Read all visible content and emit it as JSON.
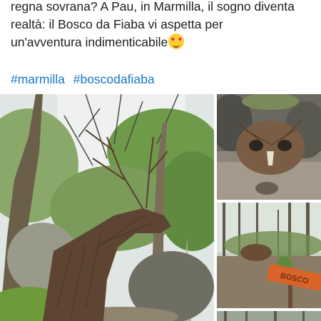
{
  "post": {
    "caption_lines": [
      "regna sovrana? A Pau, in Marmilla, il sogno diventa",
      "realtà: il Bosco da Fiaba vi aspetta per",
      "un'avventura indimenticabile"
    ],
    "emoji": "smiling-face-with-heart-eyes-icon",
    "hashtags": [
      "#marmilla",
      "#boscodafiaba"
    ]
  },
  "photos": {
    "main": "deer-branch-sculpture-photo",
    "side_1": "owl-branch-sculpture-photo",
    "side_2": "forest-sign-photo",
    "side_3": "forest-photo-partial",
    "sign_text": "BOSCO"
  },
  "colors": {
    "text": "#1c1e21",
    "hashtag": "#1877c2",
    "sign": "#d9642a"
  }
}
